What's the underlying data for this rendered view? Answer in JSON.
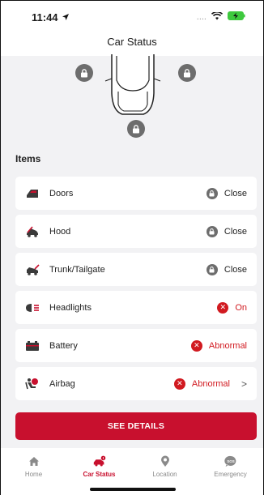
{
  "status_bar": {
    "time": "11:44",
    "signal": "....",
    "wifi_icon": "wifi-icon",
    "battery_icon": "battery-charging-icon"
  },
  "header": {
    "title": "Car Status"
  },
  "section": {
    "title": "Items"
  },
  "items": [
    {
      "label": "Doors",
      "status": "Close",
      "state": "locked",
      "icon": "door-icon"
    },
    {
      "label": "Hood",
      "status": "Close",
      "state": "locked",
      "icon": "hood-icon"
    },
    {
      "label": "Trunk/Tailgate",
      "status": "Close",
      "state": "locked",
      "icon": "trunk-icon"
    },
    {
      "label": "Headlights",
      "status": "On",
      "state": "alert",
      "icon": "headlights-icon"
    },
    {
      "label": "Battery",
      "status": "Abnormal",
      "state": "alert",
      "icon": "battery-icon"
    },
    {
      "label": "Airbag",
      "status": "Abnormal",
      "state": "alert",
      "icon": "airbag-icon"
    }
  ],
  "cta": {
    "label": "SEE DETAILS"
  },
  "tabs": [
    {
      "label": "Home",
      "icon": "home-icon",
      "active": false
    },
    {
      "label": "Car Status",
      "icon": "car-status-icon",
      "active": true
    },
    {
      "label": "Location",
      "icon": "location-pin-icon",
      "active": false
    },
    {
      "label": "Emergency",
      "icon": "sos-icon",
      "active": false
    }
  ],
  "colors": {
    "accent": "#c8102e",
    "alert": "#d11a20",
    "lock": "#6d6d6d",
    "background": "#f2f2f4"
  }
}
